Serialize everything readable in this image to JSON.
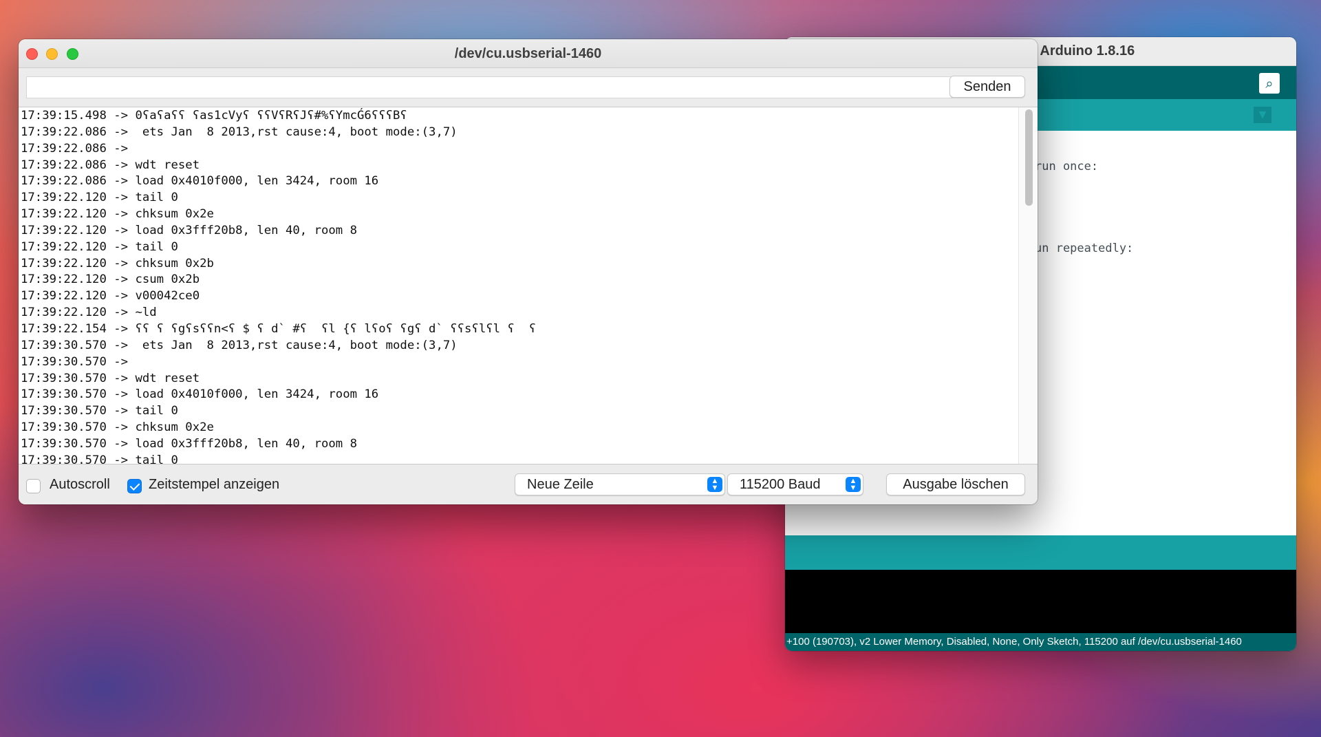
{
  "ide": {
    "title": "| Arduino 1.8.16",
    "code_fragments": [
      "run once:",
      "un repeatedly:"
    ],
    "footer_status": "+100 (190703), v2 Lower Memory, Disabled, None, Only Sketch, 115200 auf /dev/cu.usbserial-1460",
    "serial_monitor_icon": "magnifier-icon",
    "tab_menu_icon": "chevron-down-icon"
  },
  "serial_monitor": {
    "title": "/dev/cu.usbserial-1460",
    "input": {
      "value": "",
      "placeholder": ""
    },
    "send_label": "Senden",
    "lines": [
      "17:39:15.498 -> 0ʕaʕaʕʕ ʕas1cVyʕ ʕʕVʕRʕJʕ#%ʕYmcǴ6ʕʕʕBʕ",
      "17:39:22.086 ->  ets Jan  8 2013,rst cause:4, boot mode:(3,7)",
      "17:39:22.086 -> ",
      "17:39:22.086 -> wdt reset",
      "17:39:22.086 -> load 0x4010f000, len 3424, room 16",
      "17:39:22.120 -> tail 0",
      "17:39:22.120 -> chksum 0x2e",
      "17:39:22.120 -> load 0x3fff20b8, len 40, room 8",
      "17:39:22.120 -> tail 0",
      "17:39:22.120 -> chksum 0x2b",
      "17:39:22.120 -> csum 0x2b",
      "17:39:22.120 -> v00042ce0",
      "17:39:22.120 -> ~ld",
      "17:39:22.154 -> ʕʕ ʕ ʕgʕsʕʕn<ʕ $ ʕ d` #ʕ  ʕl {ʕ lʕoʕ ʕgʕ d` ʕʕsʕlʕl ʕ  ʕ",
      "17:39:30.570 ->  ets Jan  8 2013,rst cause:4, boot mode:(3,7)",
      "17:39:30.570 -> ",
      "17:39:30.570 -> wdt reset",
      "17:39:30.570 -> load 0x4010f000, len 3424, room 16",
      "17:39:30.570 -> tail 0",
      "17:39:30.570 -> chksum 0x2e",
      "17:39:30.570 -> load 0x3fff20b8, len 40, room 8",
      "17:39:30.570 -> tail 0"
    ],
    "autoscroll": {
      "label": "Autoscroll",
      "checked": false
    },
    "timestamp": {
      "label": "Zeitstempel anzeigen",
      "checked": true
    },
    "line_ending": {
      "selected": "Neue Zeile"
    },
    "baud": {
      "selected": "115200 Baud"
    },
    "clear_label": "Ausgabe löschen"
  }
}
